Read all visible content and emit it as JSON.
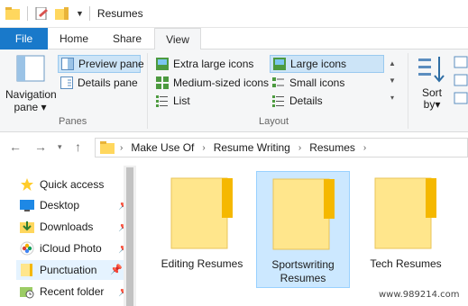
{
  "window": {
    "title": "Resumes"
  },
  "tabs": {
    "file": "File",
    "home": "Home",
    "share": "Share",
    "view": "View"
  },
  "ribbon": {
    "navigation_pane": "Navigation pane ▾",
    "preview_pane": "Preview pane",
    "details_pane": "Details pane",
    "panes_label": "Panes",
    "layouts": {
      "extra_large": "Extra large icons",
      "large": "Large icons",
      "medium": "Medium-sized icons",
      "small": "Small icons",
      "list": "List",
      "details": "Details"
    },
    "layout_label": "Layout",
    "sort_by": "Sort by▾"
  },
  "address": {
    "crumbs": [
      "Make Use Of",
      "Resume Writing",
      "Resumes"
    ]
  },
  "nav": {
    "items": [
      {
        "label": "Quick access",
        "icon": "star-icon"
      },
      {
        "label": "Desktop",
        "icon": "desktop-icon",
        "pinned": true
      },
      {
        "label": "Downloads",
        "icon": "downloads-icon",
        "pinned": true
      },
      {
        "label": "iCloud Photo",
        "icon": "icloud-photos-icon",
        "pinned": true
      },
      {
        "label": "Punctuation",
        "icon": "folder-icon",
        "pinned": true
      },
      {
        "label": "Recent folder",
        "icon": "recent-folders-icon",
        "pinned": true
      }
    ]
  },
  "folders": [
    {
      "name": "Editing Resumes"
    },
    {
      "name": "Sportswriting Resumes",
      "selected": true
    },
    {
      "name": "Tech Resumes"
    }
  ],
  "watermark": "www.989214.com",
  "colors": {
    "accent": "#1979ca",
    "selection": "#cce8ff",
    "folder": "#ffe68c",
    "folder_tab": "#f5b800"
  }
}
